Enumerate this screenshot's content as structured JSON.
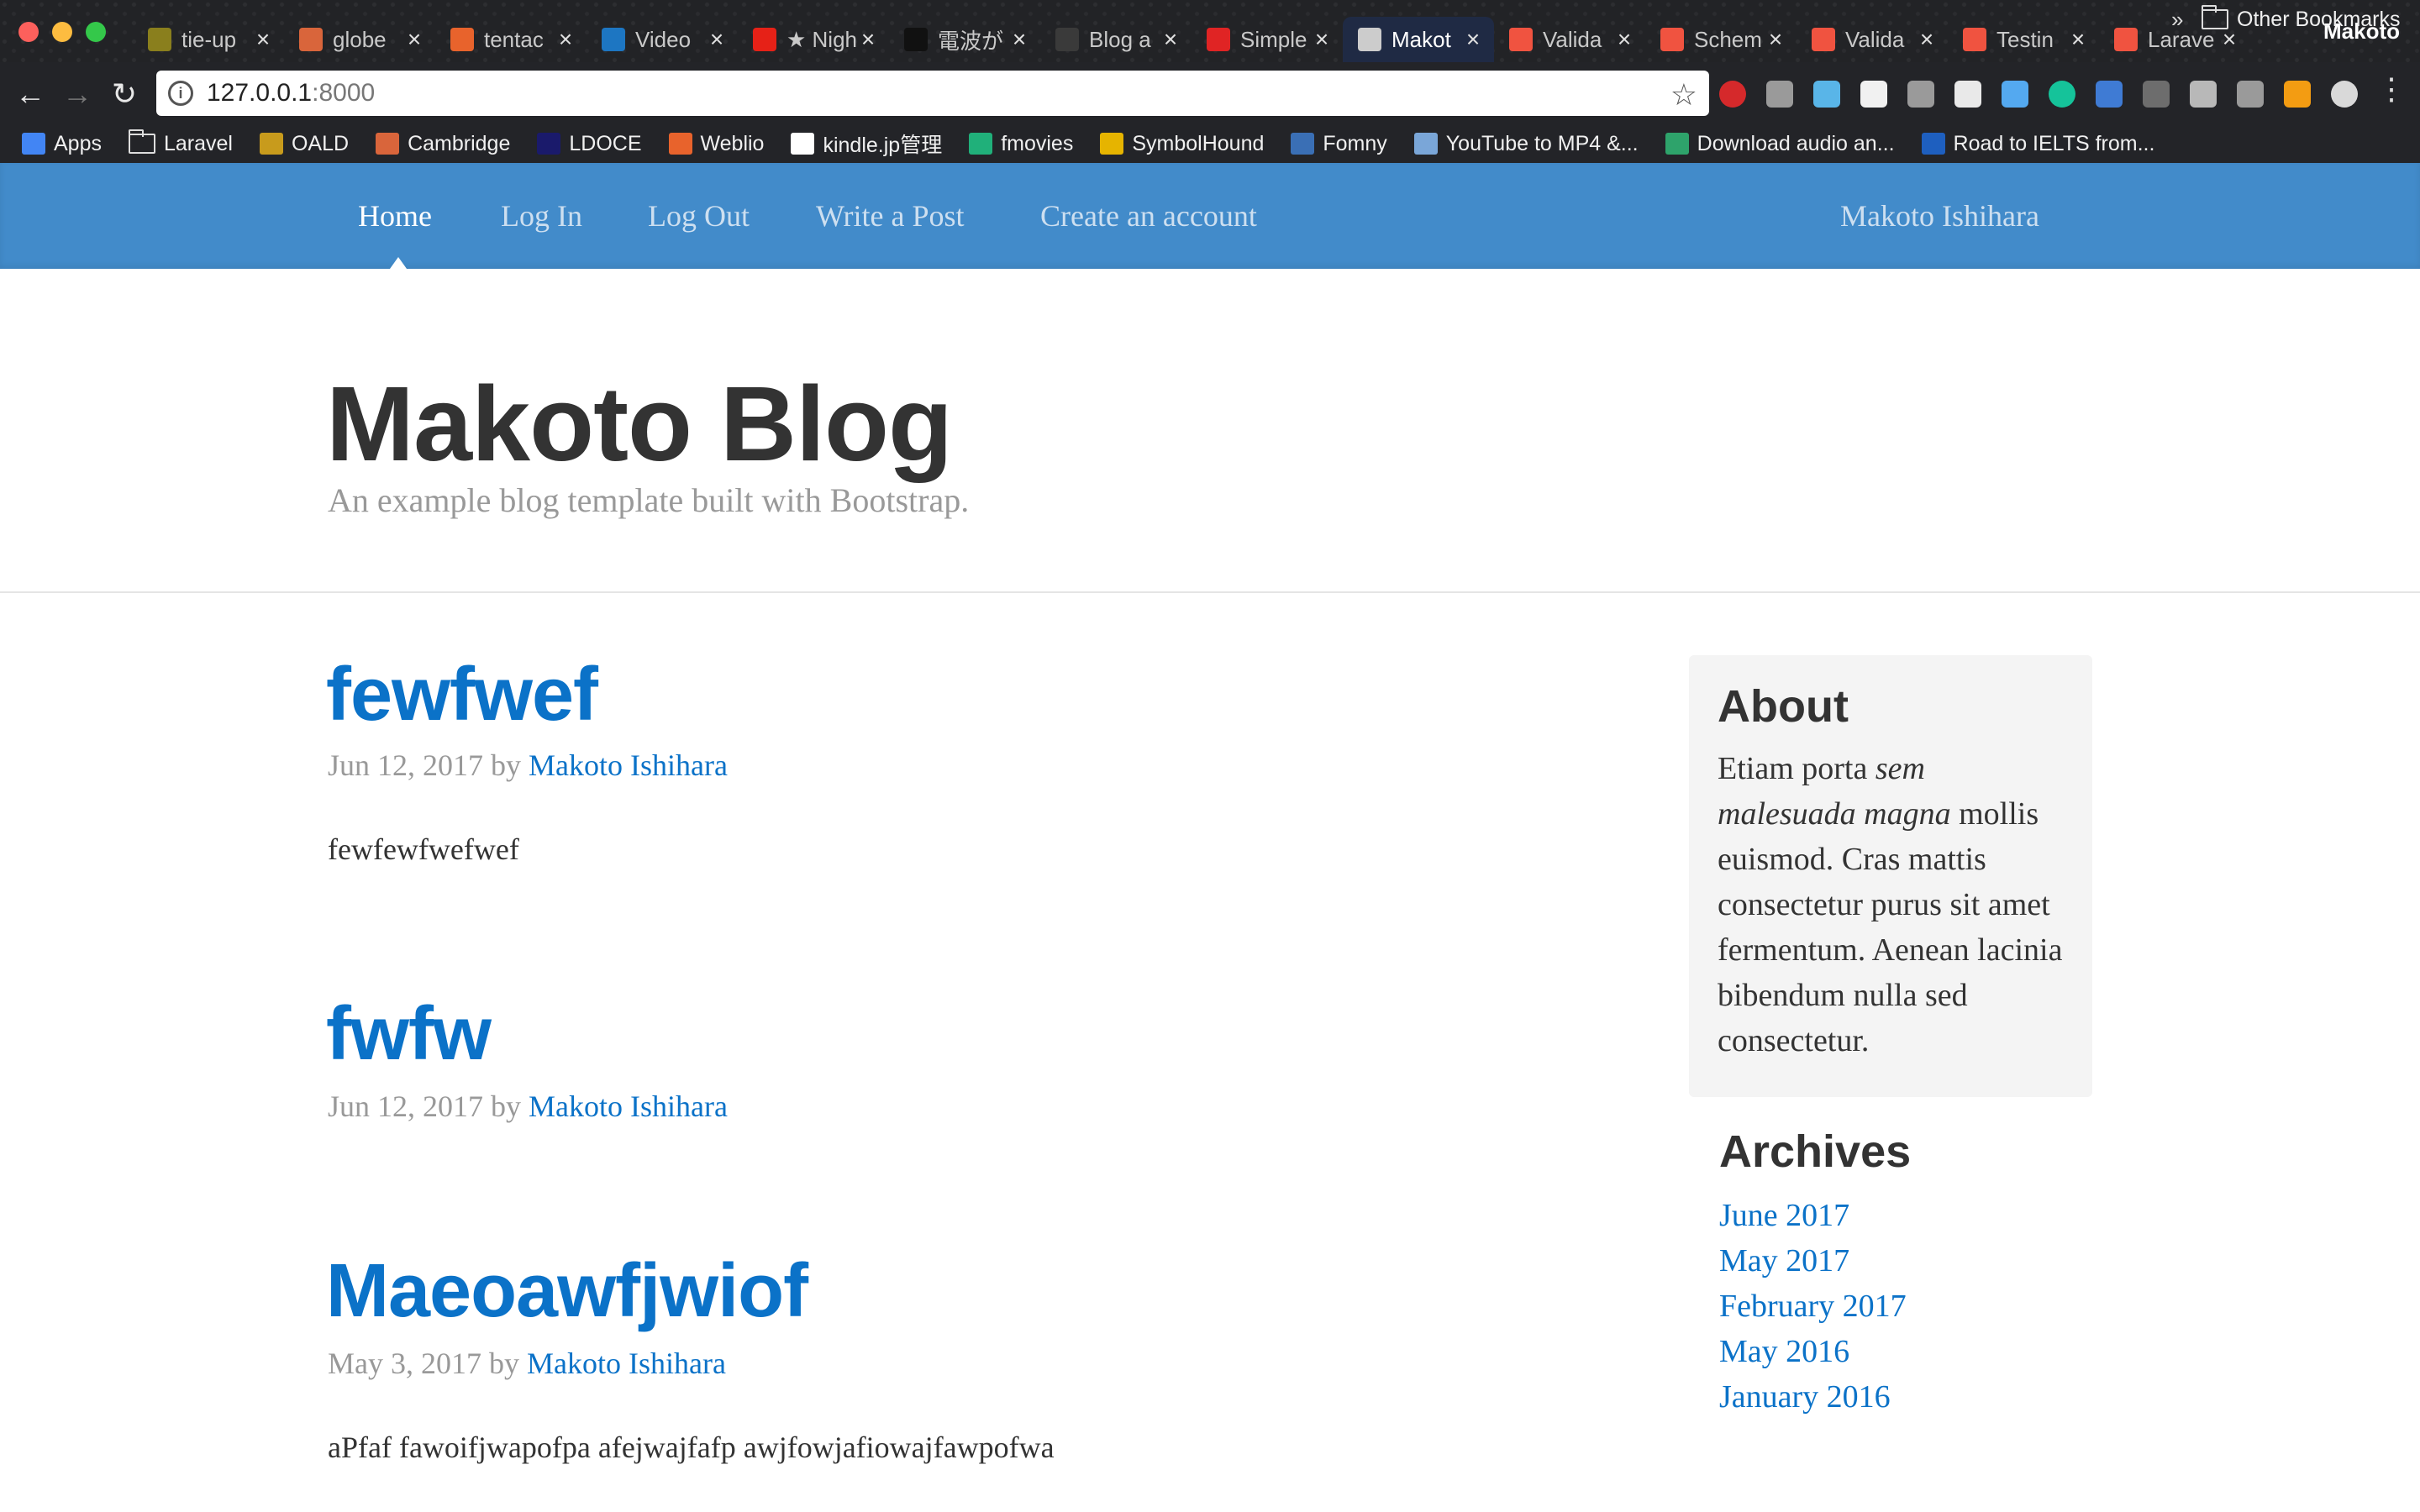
{
  "browser": {
    "profile_name": "Makoto",
    "tabs": [
      {
        "title": "tie-up",
        "icon": "tie-up-favicon",
        "color": "#8a7f1d"
      },
      {
        "title": "globe",
        "icon": "cambridge-favicon",
        "color": "#d9653b"
      },
      {
        "title": "tentac",
        "icon": "weblio-favicon",
        "color": "#e8632c"
      },
      {
        "title": "Video",
        "icon": "video-favicon",
        "color": "#1d76c2"
      },
      {
        "title": "★ Nigh",
        "icon": "youtube-icon",
        "color": "#e62117"
      },
      {
        "title": "電波が",
        "icon": "nicovideo-favicon",
        "color": "#111111"
      },
      {
        "title": "Blog a",
        "icon": "github-favicon",
        "color": "#3a3a3a"
      },
      {
        "title": "Simple",
        "icon": "simple-favicon",
        "color": "#e02424"
      },
      {
        "title": "Makot",
        "icon": "page-icon",
        "color": "#cccccc"
      },
      {
        "title": "Valida",
        "icon": "laravel-icon",
        "color": "#f05340"
      },
      {
        "title": "Schem",
        "icon": "laravel-icon",
        "color": "#f05340"
      },
      {
        "title": "Valida",
        "icon": "laravel-icon",
        "color": "#f05340"
      },
      {
        "title": "Testin",
        "icon": "laravel-icon",
        "color": "#f05340"
      },
      {
        "title": "Larave",
        "icon": "laravel-icon",
        "color": "#f05340"
      }
    ],
    "url_host": "127.0.0.1",
    "url_port": ":8000",
    "bookmarks": [
      {
        "label": "Apps",
        "icon": "apps-grid-icon",
        "color": "#4285f4"
      },
      {
        "label": "Laravel",
        "icon": "folder-icon",
        "color": ""
      },
      {
        "label": "OALD",
        "icon": "oald-favicon",
        "color": "#c89b1c"
      },
      {
        "label": "Cambridge",
        "icon": "cambridge-favicon",
        "color": "#d9653b"
      },
      {
        "label": "LDOCE",
        "icon": "ldoce-favicon",
        "color": "#1a1a6b"
      },
      {
        "label": "Weblio",
        "icon": "weblio-favicon",
        "color": "#e8632c"
      },
      {
        "label": "kindle.jp管理",
        "icon": "amazon-icon",
        "color": "#ffffff"
      },
      {
        "label": "fmovies",
        "icon": "play-icon",
        "color": "#20b07a"
      },
      {
        "label": "SymbolHound",
        "icon": "symbolhound-favicon",
        "color": "#e6b400"
      },
      {
        "label": "Fomny",
        "icon": "fomny-favicon",
        "color": "#3a6fb5"
      },
      {
        "label": "YouTube to MP4 &...",
        "icon": "youtube-mp4-favicon",
        "color": "#7aa6d8"
      },
      {
        "label": "Download audio an...",
        "icon": "rocket-icon",
        "color": "#2ea36b"
      },
      {
        "label": "Road to IELTS from...",
        "icon": "ielts-favicon",
        "color": "#1e5fbf"
      }
    ],
    "other_bookmarks": "Other Bookmarks",
    "extensions": [
      {
        "name": "adblock-plus-icon",
        "color": "#d5292b"
      },
      {
        "name": "info-ext-icon",
        "color": "#9a9a9a"
      },
      {
        "name": "diamond-icon",
        "color": "#59b5e8"
      },
      {
        "name": "note-icon",
        "color": "#f1f1f1"
      },
      {
        "name": "mail-icon",
        "color": "#9a9a9a"
      },
      {
        "name": "evernote-icon",
        "color": "#e9e9e9"
      },
      {
        "name": "cloud-icon",
        "color": "#54a9f0"
      },
      {
        "name": "grammarly-icon",
        "color": "#15c39a"
      },
      {
        "name": "bookmark-ext-icon",
        "color": "#3f7bd4"
      },
      {
        "name": "recycle-icon",
        "color": "#6d6d6d"
      },
      {
        "name": "fire-icon",
        "color": "#b8b8b8"
      },
      {
        "name": "screen-icon",
        "color": "#9a9a9a"
      },
      {
        "name": "chart-ext-icon",
        "color": "#f39c12"
      },
      {
        "name": "onetab-icon",
        "color": "#d9d9d9"
      }
    ]
  },
  "nav": {
    "home": "Home",
    "login": "Log In",
    "logout": "Log Out",
    "write": "Write a Post",
    "register": "Create an account",
    "user": "Makoto Ishihara"
  },
  "blog": {
    "title": "Makoto Blog",
    "description": "An example blog template built with Bootstrap."
  },
  "posts": [
    {
      "title": "fewfwef",
      "date": "Jun 12, 2017",
      "by": "by",
      "author": "Makoto Ishihara",
      "body": "fewfewfwefwef"
    },
    {
      "title": "fwfw",
      "date": "Jun 12, 2017",
      "by": "by",
      "author": "Makoto Ishihara",
      "body": ""
    },
    {
      "title": "Maeoawfjwiof",
      "date": "May 3, 2017",
      "by": "by",
      "author": "Makoto Ishihara",
      "body": "aPfaf fawoifjwapofpa afejwajfafp awjfowjafiowajfawpofwa"
    }
  ],
  "sidebar": {
    "about_title": "About",
    "about_text_1": "Etiam porta ",
    "about_text_em": "sem malesuada magna",
    "about_text_2": " mollis euismod. Cras mattis consectetur purus sit amet fermentum. Aenean lacinia bibendum nulla sed consectetur.",
    "archives_title": "Archives",
    "archives": [
      "June 2017",
      "May 2017",
      "February 2017",
      "May 2016",
      "January 2016"
    ]
  }
}
